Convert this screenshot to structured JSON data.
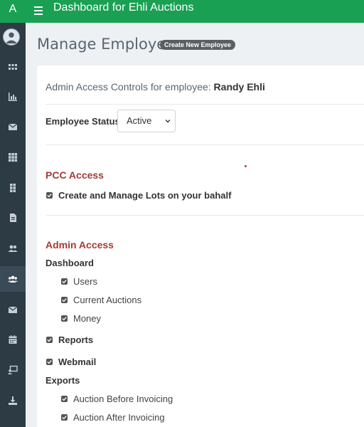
{
  "app": {
    "brand_letter": "A",
    "title": "Dashboard for Ehli Auctions",
    "accent_color": "#1aa053"
  },
  "sidebar": {
    "items": [
      {
        "icon": "grid-small-icon"
      },
      {
        "icon": "bar-chart-icon"
      },
      {
        "icon": "envelope-icon"
      },
      {
        "icon": "grid-icon"
      },
      {
        "icon": "grid-2col-icon"
      },
      {
        "icon": "document-icon"
      },
      {
        "icon": "users-icon"
      },
      {
        "icon": "user-group-icon",
        "active": true
      },
      {
        "icon": "envelope-icon"
      },
      {
        "icon": "calendar-icon"
      },
      {
        "icon": "chalkboard-user-icon"
      },
      {
        "icon": "download-icon"
      }
    ]
  },
  "header": {
    "title": "Manage Employees",
    "create_button": "Create New Employee"
  },
  "card": {
    "controls_prefix": "Admin Access Controls for employee:",
    "employee_name": "Randy Ehli",
    "status_label": "Employee Status:",
    "status_value": "Active",
    "pcc": {
      "title": "PCC Access",
      "items": [
        {
          "label": "Create and Manage Lots on your bahalf",
          "checked": true
        }
      ]
    },
    "admin": {
      "title": "Admin Access",
      "dashboard_label": "Dashboard",
      "dashboard_items": [
        {
          "label": "Users",
          "checked": true
        },
        {
          "label": "Current Auctions",
          "checked": true
        },
        {
          "label": "Money",
          "checked": true
        }
      ],
      "reports": {
        "label": "Reports",
        "checked": true
      },
      "webmail": {
        "label": "Webmail",
        "checked": true
      },
      "exports_label": "Exports",
      "exports_items": [
        {
          "label": "Auction Before Invoicing",
          "checked": true
        },
        {
          "label": "Auction After Invoicing",
          "checked": true
        }
      ]
    }
  }
}
